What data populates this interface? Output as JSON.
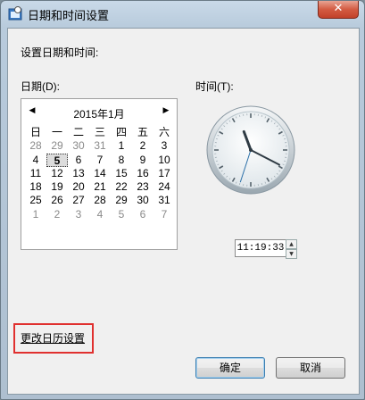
{
  "window": {
    "title": "日期和时间设置",
    "close_label": "✕"
  },
  "dialog": {
    "heading": "设置日期和时间:",
    "date_label": "日期(D):",
    "time_label": "时间(T):",
    "calendar": {
      "month_title": "2015年1月",
      "prev_arrow": "◀",
      "next_arrow": "▶",
      "weekdays": [
        "日",
        "一",
        "二",
        "三",
        "四",
        "五",
        "六"
      ],
      "days": [
        [
          "28",
          "29",
          "30",
          "31",
          "1",
          "2",
          "3"
        ],
        [
          "4",
          "5",
          "6",
          "7",
          "8",
          "9",
          "10"
        ],
        [
          "11",
          "12",
          "13",
          "14",
          "15",
          "16",
          "17"
        ],
        [
          "18",
          "19",
          "20",
          "21",
          "22",
          "23",
          "24"
        ],
        [
          "25",
          "26",
          "27",
          "28",
          "29",
          "30",
          "31"
        ],
        [
          "1",
          "2",
          "3",
          "4",
          "5",
          "6",
          "7"
        ]
      ],
      "selected_day": "5"
    },
    "clock": {
      "hour": 11,
      "minute": 19,
      "second": 33
    },
    "time_value": "11:19:33",
    "change_calendar_link": "更改日历设置",
    "ok_label": "确定",
    "cancel_label": "取消"
  }
}
